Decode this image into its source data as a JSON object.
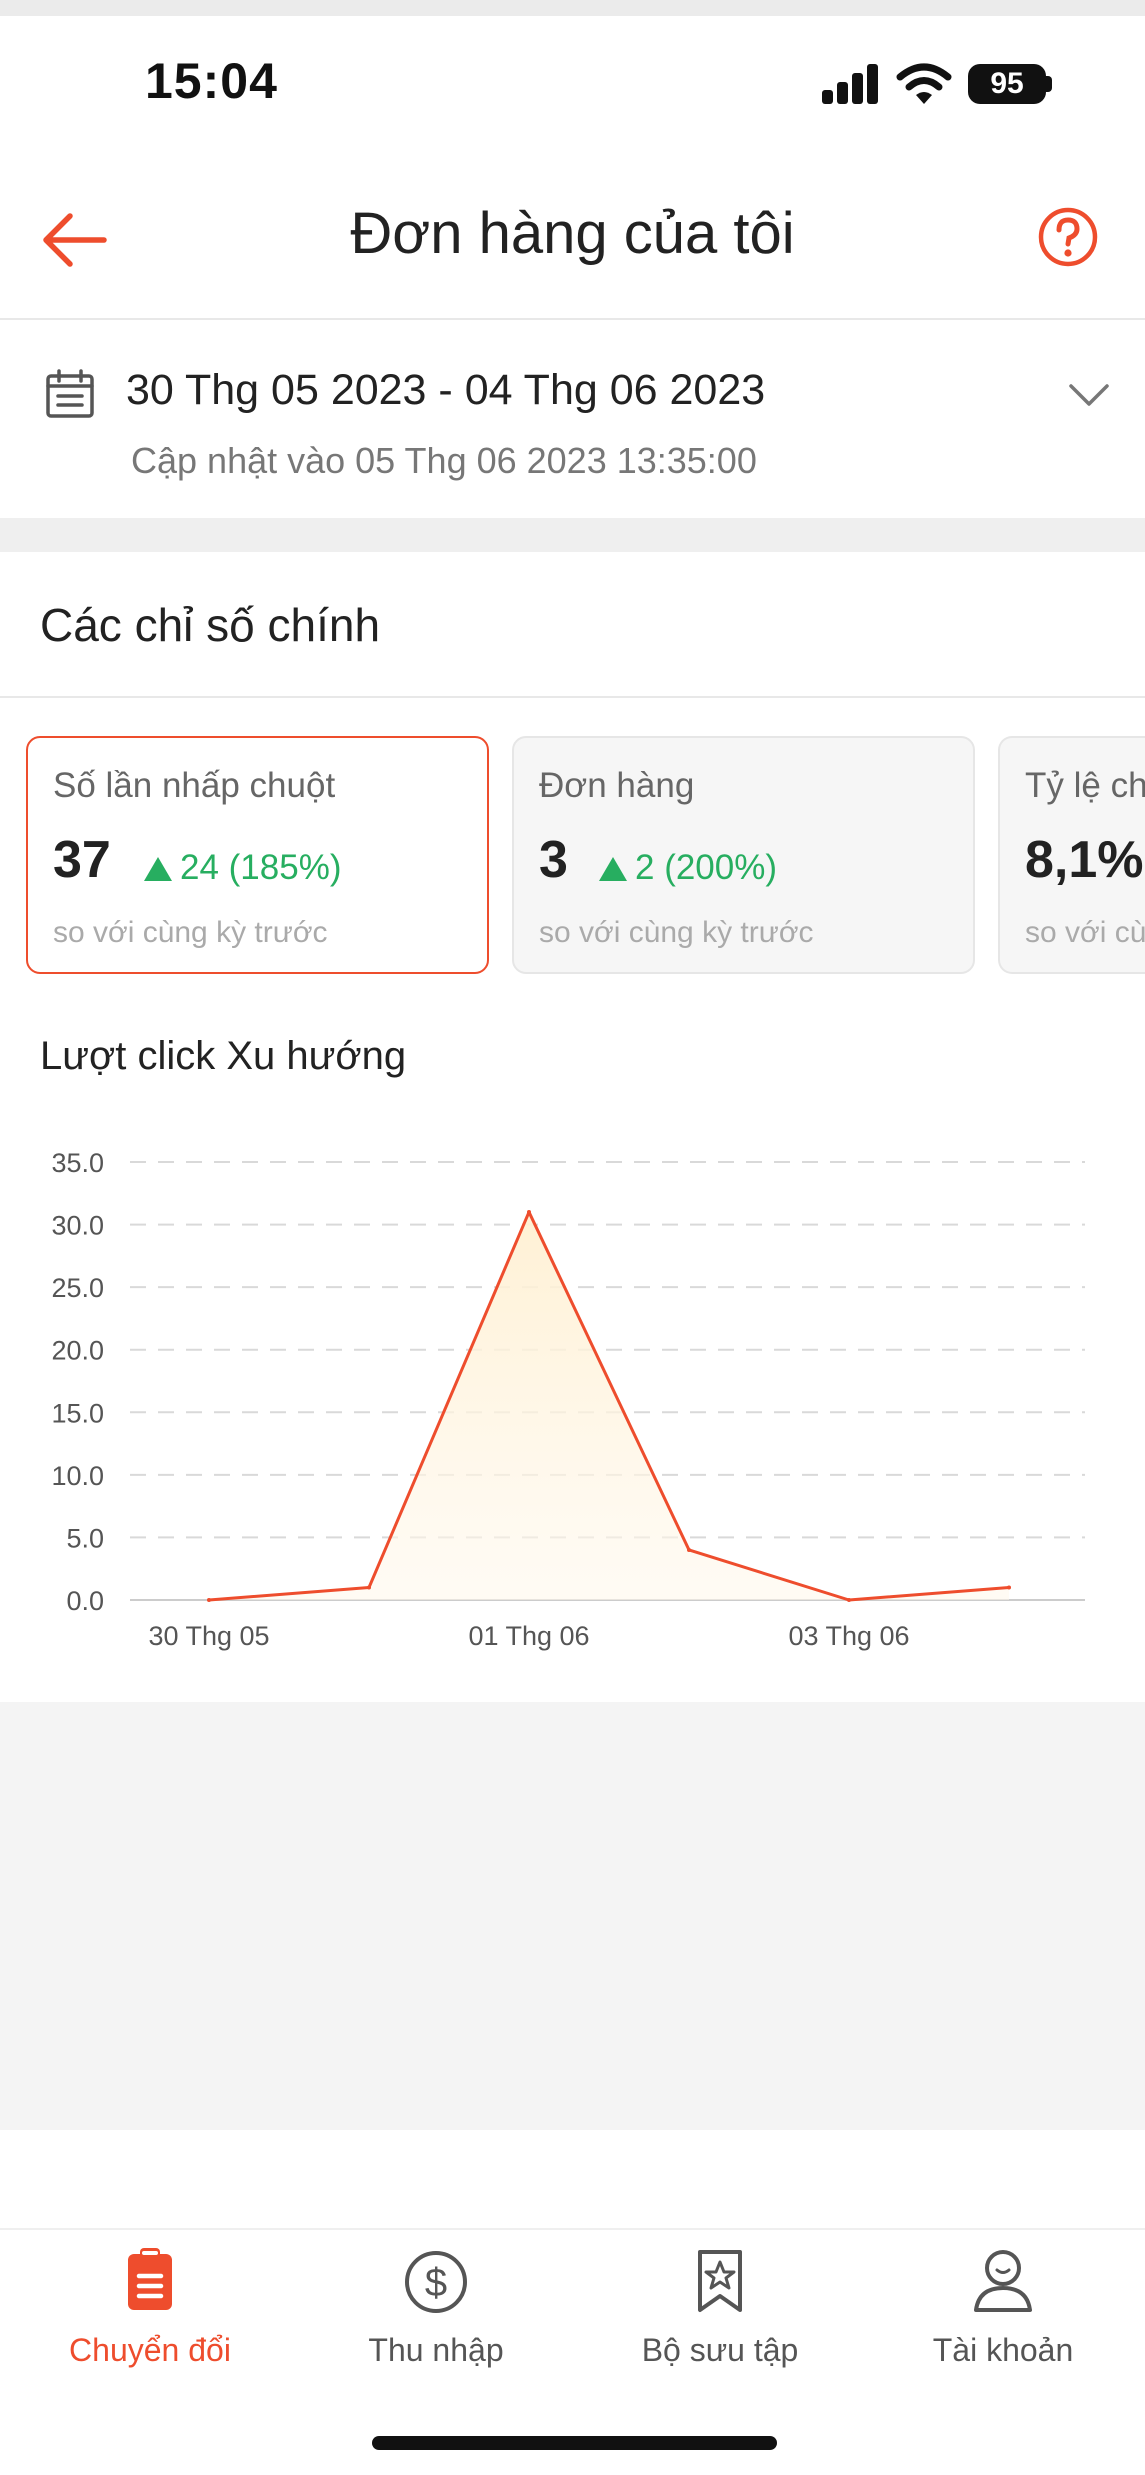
{
  "status_bar": {
    "time": "15:04",
    "battery": "95"
  },
  "header": {
    "title": "Đơn hàng của tôi",
    "back_icon": "arrow-left-icon",
    "help_icon": "question-circle-icon"
  },
  "date_filter": {
    "range": "30 Thg 05 2023 - 04 Thg 06 2023",
    "updated": "Cập nhật vào 05 Thg 06 2023 13:35:00"
  },
  "metrics": {
    "title": "Các chỉ số chính",
    "cards": [
      {
        "label": "Số lần nhấp chuột",
        "value": "37",
        "delta": "24 (185%)",
        "sub": "so với cùng kỳ trước",
        "active": true
      },
      {
        "label": "Đơn hàng",
        "value": "3",
        "delta": "2 (200%)",
        "sub": "so với cùng kỳ trước",
        "active": false
      },
      {
        "label": "Tỷ lệ chuyển đổi",
        "value": "8,1%",
        "delta": "",
        "sub": "so với cùng kỳ trước",
        "active": false
      }
    ]
  },
  "trend": {
    "title": "Lượt click Xu hướng"
  },
  "chart_data": {
    "type": "area",
    "x": [
      "30 Thg 05",
      "31 Thg 05",
      "01 Thg 06",
      "02 Thg 06",
      "03 Thg 06",
      "04 Thg 06"
    ],
    "x_tick_labels": [
      "30 Thg 05",
      "01 Thg 06",
      "03 Thg 06"
    ],
    "y_tick_labels": [
      "0.0",
      "5.0",
      "10.0",
      "15.0",
      "20.0",
      "25.0",
      "30.0",
      "35.0"
    ],
    "values": [
      0,
      1,
      31,
      4,
      0,
      1
    ],
    "ylim": [
      0,
      35
    ],
    "grid": true,
    "line_color": "#ee4d2d",
    "fill_color": "#fff3dc"
  },
  "nav": {
    "items": [
      {
        "label": "Chuyển đổi",
        "icon": "clipboard-icon",
        "active": true
      },
      {
        "label": "Thu nhập",
        "icon": "dollar-circle-icon",
        "active": false
      },
      {
        "label": "Bộ sưu tập",
        "icon": "bookmark-star-icon",
        "active": false
      },
      {
        "label": "Tài khoản",
        "icon": "user-icon",
        "active": false
      }
    ]
  },
  "colors": {
    "accent": "#ee4d2d",
    "positive": "#27ae60"
  }
}
